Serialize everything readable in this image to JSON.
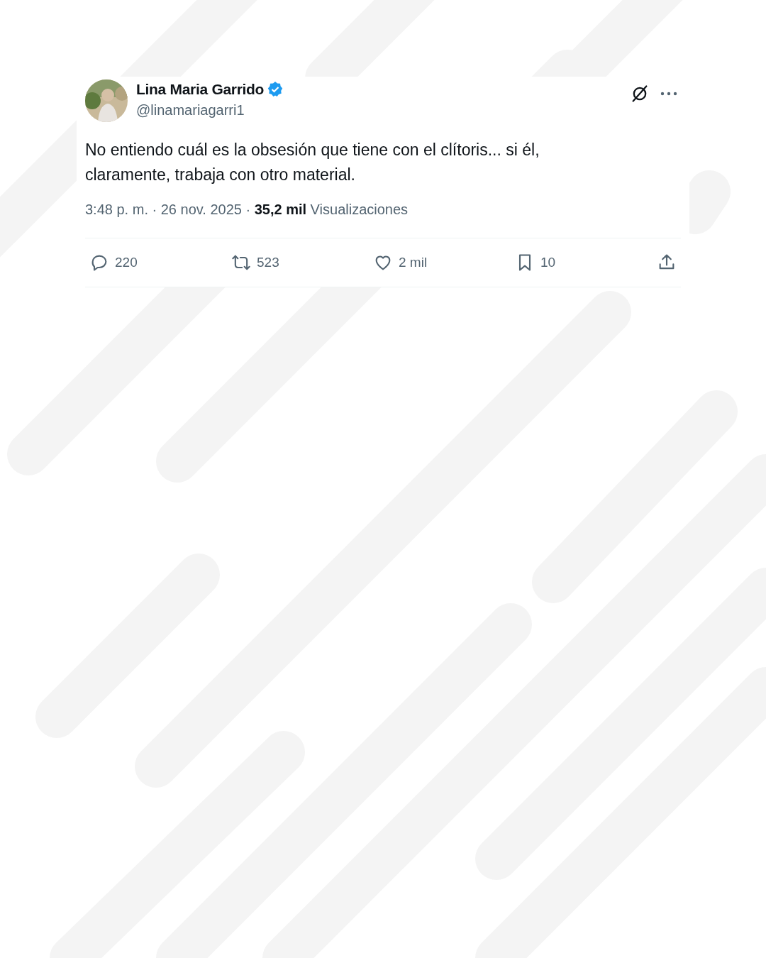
{
  "author": {
    "name": "Lina Maria Garrido",
    "verified": true,
    "handle": "@linamariagarri1"
  },
  "text": "No entiendo cuál es la obsesión que tiene con el clítoris... si él, claramente, trabaja con otro material.",
  "meta": "3:48 p. m. · 26 nov. 2025 · **35,2 mil** Visualizaciones",
  "actions": [
    {
      "kind": "reply",
      "count": "220"
    },
    {
      "kind": "repost",
      "count": "523"
    },
    {
      "kind": "like",
      "count": "2 mil"
    },
    {
      "kind": "bookmark",
      "count": "10"
    },
    {
      "kind": "share"
    }
  ]
}
